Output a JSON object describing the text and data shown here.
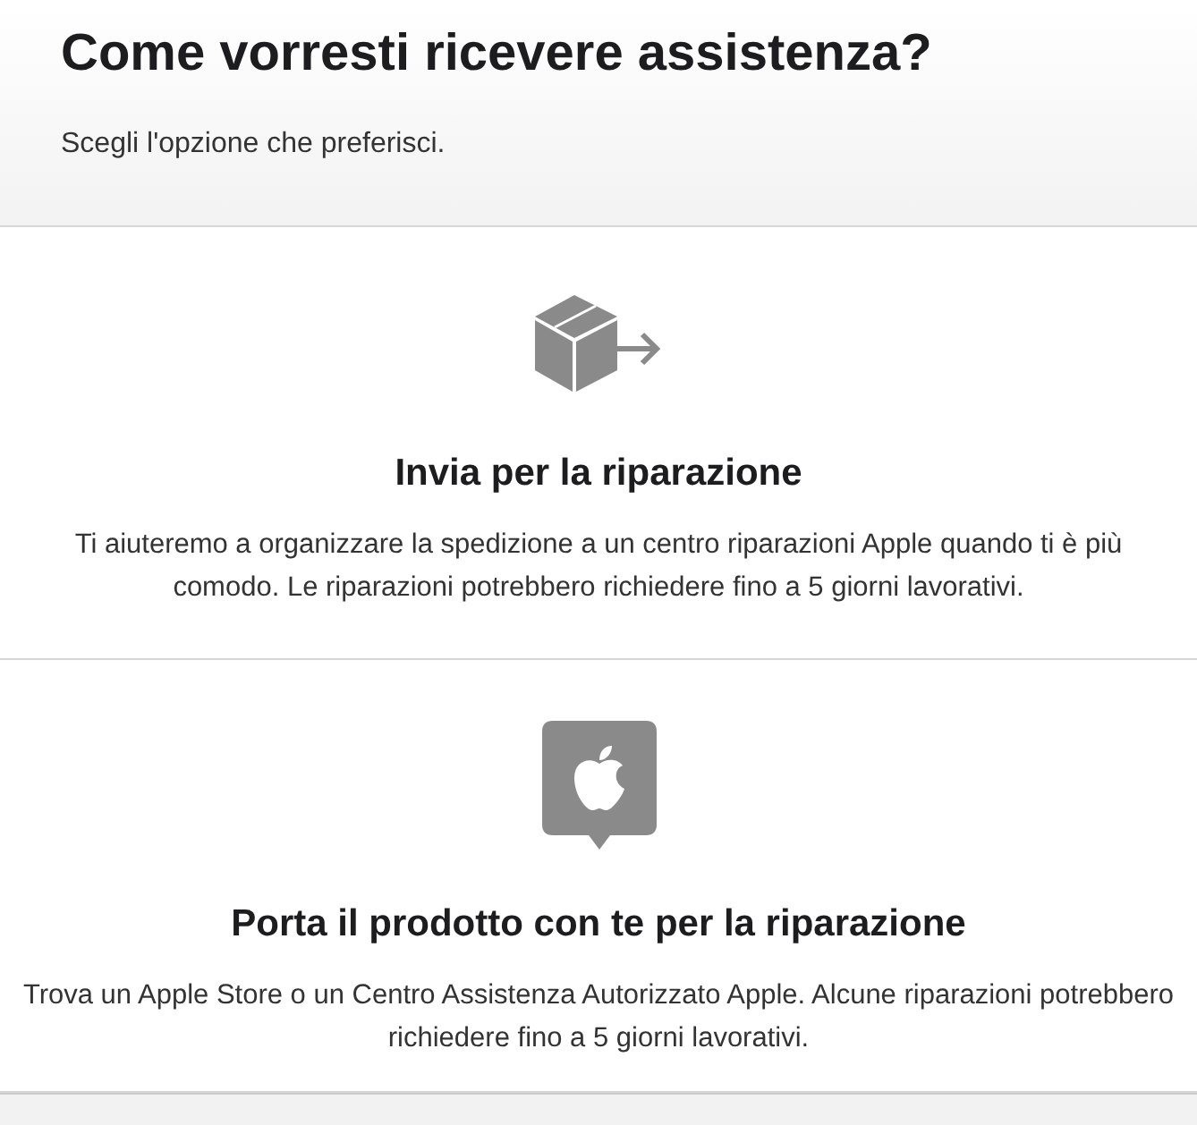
{
  "header": {
    "title": "Come vorresti ricevere assistenza?",
    "subtitle": "Scegli l'opzione che preferisci."
  },
  "options": [
    {
      "kind": "ship",
      "title": "Invia per la riparazione",
      "description": "Ti aiuteremo a organizzare la spedizione a un centro riparazioni Apple quando ti è più comodo. Le riparazioni potrebbero richiedere fino a 5 giorni lavorativi."
    },
    {
      "kind": "carry-in",
      "title": "Porta il prodotto con te per la riparazione",
      "description": "Trova un Apple Store o un Centro Assistenza Autorizzato Apple. Alcune riparazioni potrebbero richiedere fino a 5 giorni lavorativi."
    }
  ]
}
